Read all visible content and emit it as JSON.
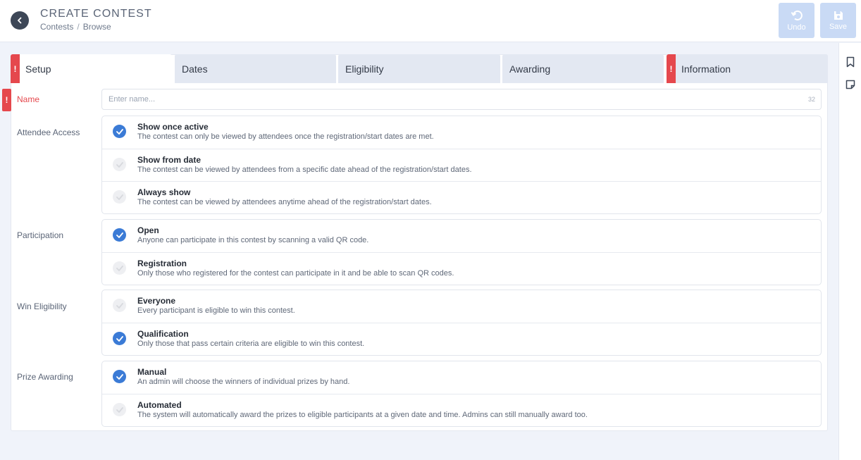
{
  "header": {
    "title": "CREATE CONTEST",
    "breadcrumb": [
      "Contests",
      "Browse"
    ],
    "breadcrumb_sep": "/",
    "undo_label": "Undo",
    "save_label": "Save"
  },
  "tabs": [
    {
      "label": "Setup",
      "active": true,
      "error": true
    },
    {
      "label": "Dates",
      "active": false,
      "error": false
    },
    {
      "label": "Eligibility",
      "active": false,
      "error": false
    },
    {
      "label": "Awarding",
      "active": false,
      "error": false
    },
    {
      "label": "Information",
      "active": false,
      "error": true
    }
  ],
  "error_mark": "!",
  "name_field": {
    "label": "Name",
    "placeholder": "Enter name...",
    "value": "",
    "max_chars": "32"
  },
  "sections": [
    {
      "label": "Attendee Access",
      "options": [
        {
          "title": "Show once active",
          "desc": "The contest can only be viewed by attendees once the registration/start dates are met.",
          "checked": true
        },
        {
          "title": "Show from date",
          "desc": "The contest can be viewed by attendees from a specific date ahead of the registration/start dates.",
          "checked": false
        },
        {
          "title": "Always show",
          "desc": "The contest can be viewed by attendees anytime ahead of the registration/start dates.",
          "checked": false
        }
      ]
    },
    {
      "label": "Participation",
      "options": [
        {
          "title": "Open",
          "desc": "Anyone can participate in this contest by scanning a valid QR code.",
          "checked": true
        },
        {
          "title": "Registration",
          "desc": "Only those who registered for the contest can participate in it and be able to scan QR codes.",
          "checked": false
        }
      ]
    },
    {
      "label": "Win Eligibility",
      "options": [
        {
          "title": "Everyone",
          "desc": "Every participant is eligible to win this contest.",
          "checked": false
        },
        {
          "title": "Qualification",
          "desc": "Only those that pass certain criteria are eligible to win this contest.",
          "checked": true
        }
      ]
    },
    {
      "label": "Prize Awarding",
      "options": [
        {
          "title": "Manual",
          "desc": "An admin will choose the winners of individual prizes by hand.",
          "checked": true
        },
        {
          "title": "Automated",
          "desc": "The system will automatically award the prizes to eligible participants at a given date and time. Admins can still manually award too.",
          "checked": false
        }
      ]
    }
  ],
  "colors": {
    "accent": "#3b7bd6",
    "error": "#e5484d",
    "disabled_button": "#c9daf5"
  },
  "icons": {
    "back": "chevron-left-icon",
    "undo": "undo-icon",
    "save": "floppy-disk-icon",
    "rail_top": "bookmark-icon",
    "rail_bottom": "note-icon",
    "checked": "check-icon"
  }
}
